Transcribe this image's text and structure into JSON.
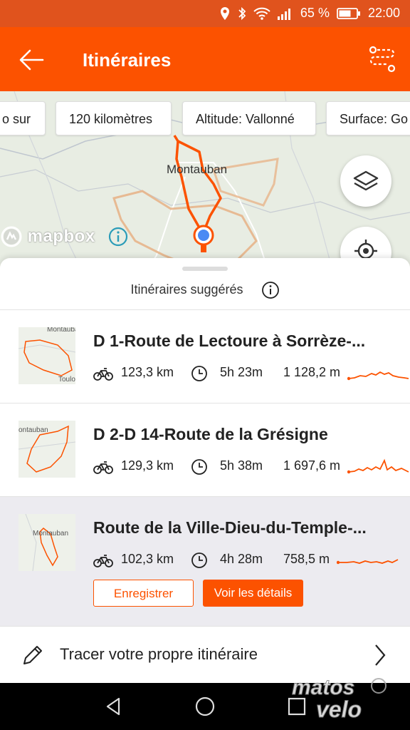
{
  "status_bar": {
    "battery_percent": "65 %",
    "time": "22:00"
  },
  "app_bar": {
    "title": "Itinéraires"
  },
  "map": {
    "chips": [
      "o sur",
      "120 kilomètres",
      "Altitude: Vallonné",
      "Surface: Go"
    ],
    "city_label": "Montauban",
    "attribution": "mapbox"
  },
  "sheet": {
    "header": "Itinéraires suggérés",
    "routes": [
      {
        "name": "D 1-Route de Lectoure à Sorrèze-...",
        "distance": "123,3 km",
        "duration": "5h 23m",
        "elevation": "1 128,2 m",
        "thumb_label_top": "Montauban",
        "thumb_label_bottom": "Toulo"
      },
      {
        "name": "D 2-D 14-Route de la Grésigne",
        "distance": "129,3 km",
        "duration": "5h 38m",
        "elevation": "1 697,6 m",
        "thumb_label_top": "ontauban"
      },
      {
        "name": "Route de la Ville-Dieu-du-Temple-...",
        "distance": "102,3 km",
        "duration": "4h 28m",
        "elevation": "758,5 m",
        "thumb_label_top": "Montauban"
      }
    ],
    "buttons": {
      "save": "Enregistrer",
      "details": "Voir les détails"
    },
    "draw_own": "Tracer votre propre itinéraire"
  },
  "watermark": {
    "line1": "matos",
    "line2": "velo"
  },
  "colors": {
    "accent": "#fc5200",
    "status_bar": "#e0531d"
  }
}
